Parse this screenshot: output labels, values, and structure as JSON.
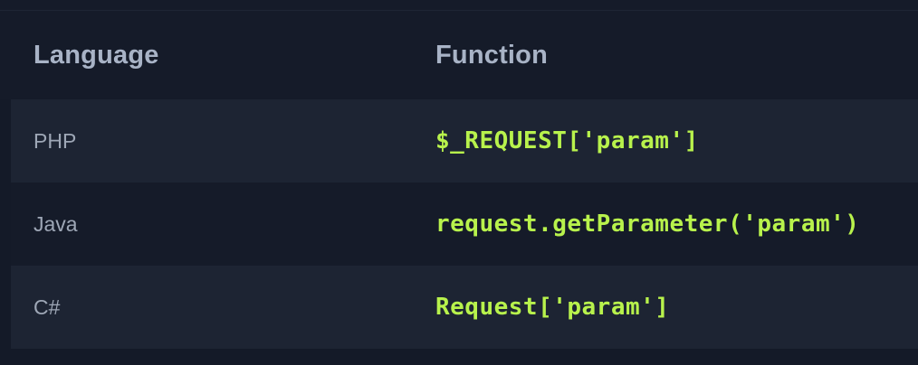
{
  "table": {
    "headers": {
      "language": "Language",
      "function": "Function"
    },
    "rows": [
      {
        "language": "PHP",
        "function": "$_REQUEST['param']"
      },
      {
        "language": "Java",
        "function": "request.getParameter('param')"
      },
      {
        "language": "C#",
        "function": "Request['param']"
      }
    ]
  },
  "colors": {
    "background": "#141a28",
    "alt_row": "#1d2433",
    "header_text": "#a8b3c6",
    "body_text": "#9ea7b6",
    "code_text": "#b8f24c"
  }
}
